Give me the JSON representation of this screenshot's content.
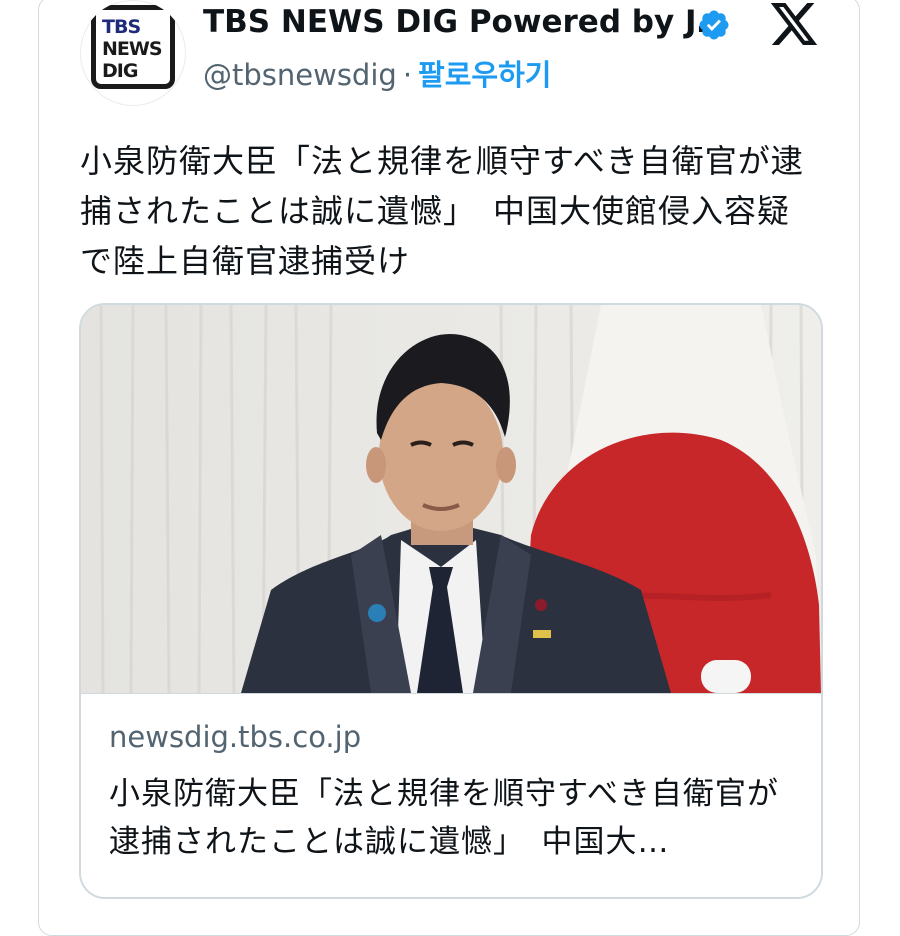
{
  "account": {
    "display_name": "TBS NEWS DIG Powered by J…",
    "handle": "@tbsnewsdig",
    "separator": "·",
    "follow_label": "팔로우하기",
    "avatar_logo_lines": [
      "TBS",
      "NEWS",
      "DIG"
    ]
  },
  "tweet": {
    "text": "小泉防衛大臣「法と規律を順守すべき自衛官が逮捕されたことは誠に遺憾」　中国大使館侵入容疑で陸上自衛官逮捕受け"
  },
  "link_card": {
    "domain": "newsdig.tbs.co.jp",
    "title": "小泉防衛大臣「法と規律を順守すべき自衛官が逮捕されたことは誠に遺憾」　中国大…"
  },
  "icons": {
    "verified": "verified-badge-icon",
    "platform": "x-logo-icon"
  },
  "colors": {
    "accent": "#1d9bf0",
    "flag_red": "#c8272a"
  }
}
